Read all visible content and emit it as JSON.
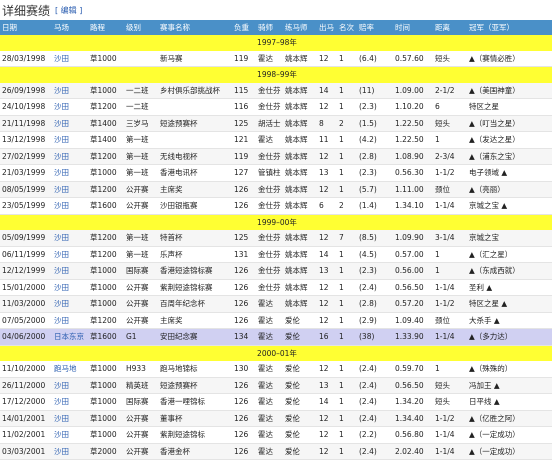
{
  "section_title": "详细赛绩",
  "edit_label": "[ 编辑 ]",
  "columns": [
    "日期",
    "马场",
    "路程",
    "级别",
    "赛事名称",
    "负重",
    "骑师",
    "练马师",
    "出马",
    "名次",
    "赔率",
    "时间",
    "距离",
    "冠军（亚军）"
  ],
  "seasons": [
    {
      "label": "1997–98年",
      "rows": [
        [
          "28/03/1998",
          "沙田",
          "草1000",
          "",
          "新马赛",
          "119",
          "霍达",
          "姚本辉",
          "12",
          "1",
          "(6.4)",
          "0.57.60",
          "短头",
          "▲（赛情必胜）"
        ]
      ]
    },
    {
      "label": "1998–99年",
      "rows": [
        [
          "26/09/1998",
          "沙田",
          "草1000",
          "一二班",
          "乡村俱乐部挑战杯",
          "115",
          "金仕芬",
          "姚本辉",
          "14",
          "1",
          "(11)",
          "1.09.00",
          "2-1/2",
          "▲（美国神童）"
        ],
        [
          "24/10/1998",
          "沙田",
          "草1200",
          "一二班",
          "",
          "116",
          "金仕芬",
          "姚本辉",
          "12",
          "1",
          "(2.3)",
          "1.10.20",
          "6",
          "特区之星"
        ],
        [
          "21/11/1998",
          "沙田",
          "草1400",
          "三岁马",
          "短途预赛杯",
          "125",
          "胡活士",
          "姚本辉",
          "8",
          "2",
          "(1.5)",
          "1.22.50",
          "短头",
          "▲（叮当之星）"
        ],
        [
          "13/12/1998",
          "沙田",
          "草1400",
          "第一班",
          "",
          "121",
          "霍达",
          "姚本辉",
          "11",
          "1",
          "(4.2)",
          "1.22.50",
          "1",
          "▲（发达之星）"
        ],
        [
          "27/02/1999",
          "沙田",
          "草1200",
          "第一班",
          "无线电视杯",
          "119",
          "金仕芬",
          "姚本辉",
          "12",
          "1",
          "(2.8)",
          "1.08.90",
          "2-3/4",
          "▲（浦东之宝）"
        ],
        [
          "21/03/1999",
          "沙田",
          "草1000",
          "第一班",
          "香港电讯杯",
          "127",
          "管镇柱",
          "姚本辉",
          "13",
          "1",
          "(2.3)",
          "0.56.30",
          "1-1/2",
          "电子领域 ▲"
        ],
        [
          "08/05/1999",
          "沙田",
          "草1200",
          "公开赛",
          "主席奖",
          "126",
          "金仕芬",
          "姚本辉",
          "12",
          "1",
          "(5.7)",
          "1.11.00",
          "颈位",
          "▲（亮丽）"
        ],
        [
          "23/05/1999",
          "沙田",
          "草1600",
          "公开赛",
          "沙田银瓶赛",
          "126",
          "金仕芬",
          "姚本辉",
          "6",
          "2",
          "(1.4)",
          "1.34.10",
          "1-1/4",
          "京城之宝 ▲"
        ]
      ]
    },
    {
      "label": "1999–00年",
      "rows": [
        [
          "05/09/1999",
          "沙田",
          "草1200",
          "第一班",
          "特首杯",
          "125",
          "金仕芬",
          "姚本辉",
          "12",
          "7",
          "(8.5)",
          "1.09.90",
          "3-1/4",
          "京城之宝"
        ],
        [
          "06/11/1999",
          "沙田",
          "草1200",
          "第一班",
          "乐声杯",
          "131",
          "金仕芬",
          "姚本辉",
          "14",
          "1",
          "(4.5)",
          "0.57.00",
          "1",
          "▲（汇之星）"
        ],
        [
          "12/12/1999",
          "沙田",
          "草1000",
          "国际赛",
          "香港短途锦标赛",
          "126",
          "金仕芬",
          "姚本辉",
          "13",
          "1",
          "(2.3)",
          "0.56.00",
          "1",
          "▲（东成西就）"
        ],
        [
          "15/01/2000",
          "沙田",
          "草1000",
          "公开赛",
          "紫荆短途锦标赛",
          "126",
          "金仕芬",
          "姚本辉",
          "12",
          "1",
          "(2.4)",
          "0.56.50",
          "1-1/4",
          "圣利 ▲"
        ],
        [
          "11/03/2000",
          "沙田",
          "草1000",
          "公开赛",
          "百周年纪念杯",
          "126",
          "霍达",
          "姚本辉",
          "12",
          "1",
          "(2.8)",
          "0.57.20",
          "1-1/2",
          "特区之星 ▲"
        ],
        [
          "07/05/2000",
          "沙田",
          "草1200",
          "公开赛",
          "主席奖",
          "126",
          "霍达",
          "爱伦",
          "12",
          "1",
          "(2.9)",
          "1.09.40",
          "颈位",
          "大杀手 ▲"
        ],
        [
          "04/06/2000",
          "日本东京",
          "草1600",
          "G1",
          "安田纪念赛",
          "134",
          "霍达",
          "爱伦",
          "16",
          "1",
          "(38)",
          "1.33.90",
          "1-1/4",
          "▲（多力达）"
        ]
      ]
    },
    {
      "label": "2000–01年",
      "rows": [
        [
          "11/10/2000",
          "跑马地",
          "草1000",
          "H933",
          "跑马地锦标",
          "130",
          "霍达",
          "爱伦",
          "12",
          "1",
          "(2.4)",
          "0.59.70",
          "1",
          "▲（殊殊的）"
        ],
        [
          "26/11/2000",
          "沙田",
          "草1000",
          "精英班",
          "短途预赛杯",
          "126",
          "霍达",
          "爱伦",
          "13",
          "1",
          "(2.4)",
          "0.56.50",
          "短头",
          "冯加王 ▲"
        ],
        [
          "17/12/2000",
          "沙田",
          "草1000",
          "国际赛",
          "香港一哩锦标",
          "126",
          "霍达",
          "爱伦",
          "14",
          "1",
          "(2.4)",
          "1.34.20",
          "短头",
          "日平线 ▲"
        ],
        [
          "14/01/2001",
          "沙田",
          "草1000",
          "公开赛",
          "董事杯",
          "126",
          "霍达",
          "爱伦",
          "12",
          "1",
          "(2.4)",
          "1.34.40",
          "1-1/2",
          "▲（亿胜之阿）"
        ],
        [
          "11/02/2001",
          "沙田",
          "草1000",
          "公开赛",
          "紫荆短途锦标",
          "126",
          "霍达",
          "爱伦",
          "12",
          "1",
          "(2.2)",
          "0.56.80",
          "1-1/4",
          "▲（一定成功）"
        ],
        [
          "03/03/2001",
          "沙田",
          "草2000",
          "公开赛",
          "香港金杯",
          "126",
          "霍达",
          "爱伦",
          "12",
          "1",
          "(2.4)",
          "2.02.40",
          "1-1/4",
          "▲（一定成功）"
        ]
      ]
    }
  ]
}
